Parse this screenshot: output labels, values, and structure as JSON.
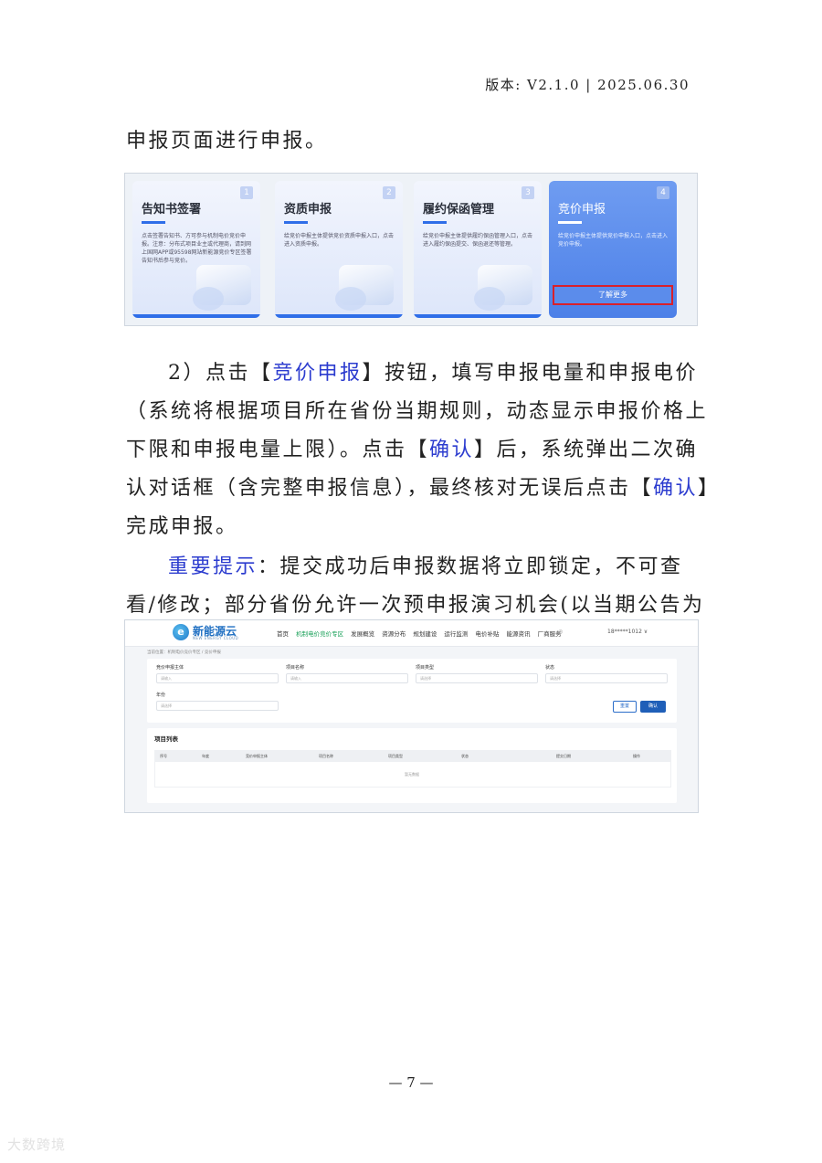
{
  "header": {
    "version": "版本: V2.1.0 | 2025.06.30"
  },
  "para1": "申报页面进行申报。",
  "cards": [
    {
      "num": "1",
      "title": "告知书签署",
      "desc": "点击签署告知书、方可参与机制电价竞价申报。注意：分布式项目业主或代理商，请到网上国网APP或95598网站新能源竞价专区签署告知书后参与竞价。"
    },
    {
      "num": "2",
      "title": "资质申报",
      "desc": "给竞价申报主体提供竞价资质申报入口，点击进入资质申报。"
    },
    {
      "num": "3",
      "title": "履约保函管理",
      "desc": "给竞价申报主体提供履约保函管理入口，点击进入履约保函提交、保函退还等管理。"
    },
    {
      "num": "4",
      "title": "竞价申报",
      "desc": "给竞价申报主体提供竞价申报入口，点击进入竞价申报。",
      "button": "了解更多"
    }
  ],
  "para2": {
    "prefix": "2）点击【",
    "link1": "竞价申报",
    "mid1": "】按钮，填写申报电量和申报电价（系统将根据项目所在省份当期规则，动态显示申报价格上下限和申报电量上限）。点击【",
    "link2": "确认",
    "mid2": "】后，系统弹出二次确认对话框（含完整申报信息），最终核对无误后点击【",
    "link3": "确认",
    "suffix": "】完成申报。"
  },
  "para3": {
    "label": "重要提示",
    "text": "：提交成功后申报数据将立即锁定，不可查看/修改；部分省份允许一次预申报演习机会(以当期公告为准)。"
  },
  "web": {
    "logo_text": "新能源云",
    "logo_sub": "NEW ENERGY CLOUD",
    "nav": [
      "首页",
      "机制电价竞价专区",
      "发展概览",
      "资源分布",
      "规划建设",
      "运行监测",
      "电价补贴",
      "能源资讯",
      "厂商服务"
    ],
    "user": "18*****1012 ∨",
    "breadcrumb": "当前位置：机制电价竞价专区 / 竞价申报",
    "filters": [
      {
        "label": "竞价申报主体",
        "placeholder": "请输入"
      },
      {
        "label": "项目名称",
        "placeholder": "请输入"
      },
      {
        "label": "项目类型",
        "placeholder": "请选择"
      },
      {
        "label": "状态",
        "placeholder": "请选择"
      },
      {
        "label": "年份",
        "placeholder": "请选择"
      }
    ],
    "reset": "重置",
    "confirm": "确认",
    "list_title": "项目列表",
    "columns": [
      "序号",
      "年度",
      "竞价申报主体",
      "项目名称",
      "项目类型",
      "状态",
      "提交日期",
      "操作"
    ],
    "empty": "暂无数据"
  },
  "footer": {
    "page": "— 7 —",
    "watermark": "大数跨境"
  }
}
